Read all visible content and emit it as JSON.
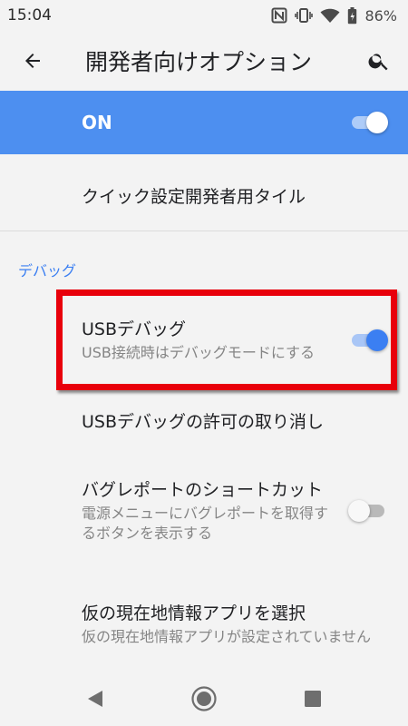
{
  "status_bar": {
    "time": "15:04",
    "battery": "86%"
  },
  "header": {
    "title": "開発者向けオプション"
  },
  "master_switch": {
    "label": "ON",
    "checked": true
  },
  "rows": {
    "quick_tiles": {
      "title": "クイック設定開発者用タイル"
    },
    "category_debug": "デバッグ",
    "usb_debugging": {
      "title": "USBデバッグ",
      "summary": "USB接続時はデバッグモードにする",
      "checked": true
    },
    "revoke_usb": {
      "title": "USBデバッグの許可の取り消し"
    },
    "bugreport_shortcut": {
      "title": "バグレポートのショートカット",
      "summary": "電源メニューにバグレポートを取得するボタンを表示する",
      "checked": false
    },
    "mock_location": {
      "title": "仮の現在地情報アプリを選択",
      "summary": "仮の現在地情報アプリが設定されていません"
    }
  },
  "icons": {
    "nfc": "nfc-icon",
    "vibrate": "vibrate-icon",
    "wifi": "wifi-icon",
    "battery": "battery-icon",
    "back": "arrow-back-icon",
    "search": "search-icon",
    "nav_back": "triangle-back-icon",
    "nav_home": "circle-home-icon",
    "nav_recents": "square-recents-icon"
  },
  "colors": {
    "accent": "#3b7ff2",
    "banner": "#4d8ff0",
    "highlight": "#e8000b",
    "background": "#f3f3f3"
  }
}
